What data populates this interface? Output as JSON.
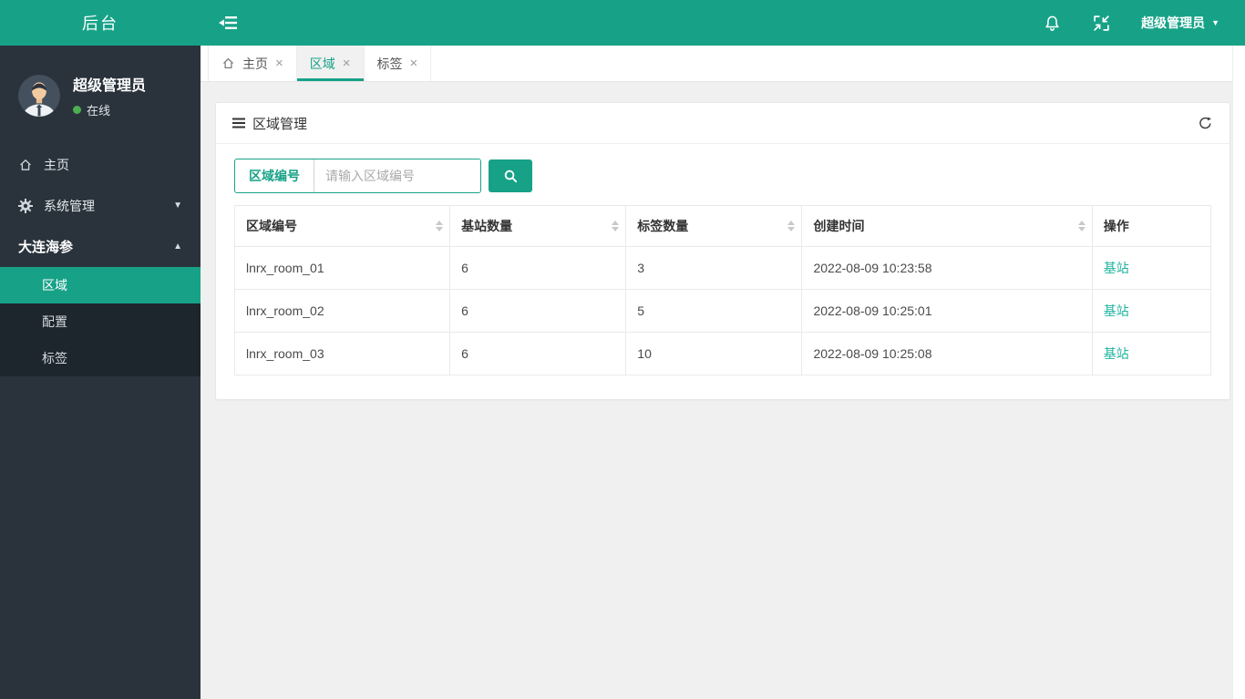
{
  "brand": {
    "logo_text": "后台"
  },
  "header": {
    "user_name": "超级管理员"
  },
  "icons": {
    "caret_down": "▼",
    "caret_up": "▲",
    "close": "×"
  },
  "sidebar": {
    "user": {
      "name": "超级管理员",
      "status": "在线"
    },
    "menu": [
      {
        "label": "主页",
        "icon": "home"
      },
      {
        "label": "系统管理",
        "icon": "gear",
        "caret": "down"
      },
      {
        "label": "大连海参",
        "caret": "up"
      }
    ],
    "submenu": [
      {
        "label": "区域",
        "active": true
      },
      {
        "label": "配置"
      },
      {
        "label": "标签"
      }
    ]
  },
  "tabs": [
    {
      "label": "主页",
      "icon": "home"
    },
    {
      "label": "区域",
      "active": true
    },
    {
      "label": "标签"
    }
  ],
  "panel": {
    "title": "区域管理",
    "search": {
      "label": "区域编号",
      "placeholder": "请输入区域编号"
    },
    "table": {
      "columns": [
        {
          "label": "区域编号",
          "sortable": true
        },
        {
          "label": "基站数量",
          "sortable": true
        },
        {
          "label": "标签数量",
          "sortable": true
        },
        {
          "label": "创建时间",
          "sortable": true
        },
        {
          "label": "操作",
          "sortable": false
        }
      ],
      "rows": [
        {
          "area_id": "lnrx_room_01",
          "base_stations": "6",
          "tag_count": "3",
          "created_at": "2022-08-09 10:23:58",
          "action": "基站"
        },
        {
          "area_id": "lnrx_room_02",
          "base_stations": "6",
          "tag_count": "5",
          "created_at": "2022-08-09 10:25:01",
          "action": "基站"
        },
        {
          "area_id": "lnrx_room_03",
          "base_stations": "6",
          "tag_count": "10",
          "created_at": "2022-08-09 10:25:08",
          "action": "基站"
        }
      ]
    }
  },
  "colors": {
    "accent": "#17a287",
    "link": "#1fb3a0",
    "status_online": "#4caf50",
    "sidebar_bg": "#2a333c",
    "submenu_bg": "#1d252d",
    "content_bg": "#f0f0f0"
  }
}
